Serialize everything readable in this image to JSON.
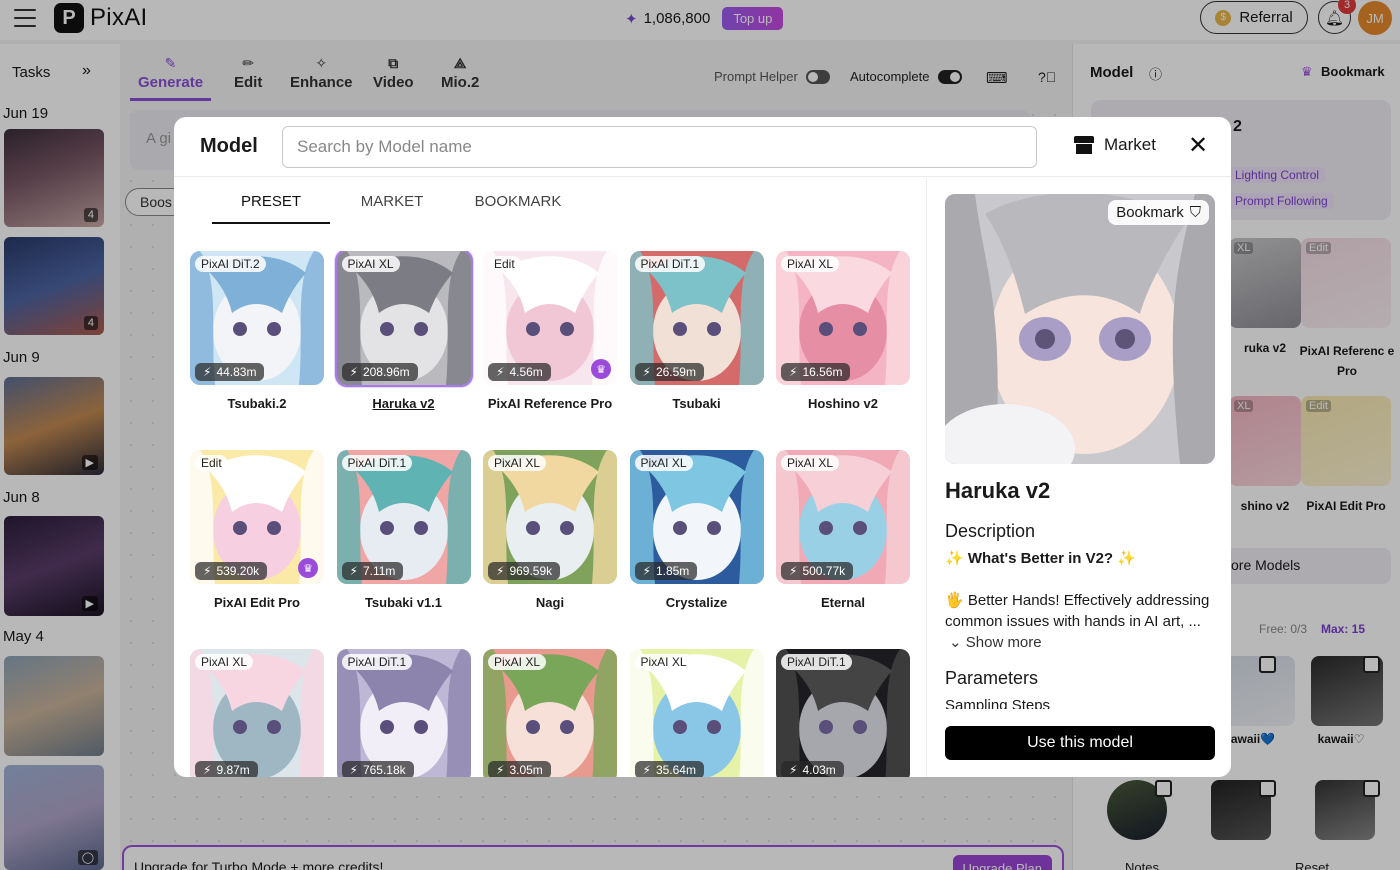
{
  "header": {
    "brand": "PixAI",
    "credits": "1,086,800",
    "topup_label": "Top up",
    "referral_label": "Referral",
    "notification_count": "3",
    "avatar_initials": "JM"
  },
  "tasks": {
    "title": "Tasks",
    "dates": [
      "Jun 19",
      "Jun 9",
      "Jun 8",
      "May 4"
    ],
    "badges": [
      "4",
      "4"
    ]
  },
  "toolbar": {
    "tools": [
      "Generate",
      "Edit",
      "Enhance",
      "Video",
      "Mio.2"
    ],
    "prompt_helper_label": "Prompt Helper",
    "autocomplete_label": "Autocomplete",
    "prompt_placeholder": "A gi",
    "boost_label": "Boos"
  },
  "upgrade": {
    "text": "Upgrade for Turbo Mode + more credits!",
    "button": "Upgrade Plan"
  },
  "right_panel": {
    "title": "Model",
    "bookmark_label": "Bookmark",
    "model_name_partial": "2",
    "pills": [
      "Lighting Control",
      "Prompt Following"
    ],
    "tiles": [
      {
        "tag": "XL",
        "label": "ruka v2"
      },
      {
        "tag": "Edit",
        "label": "PixAI Referenc e Pro"
      },
      {
        "tag": "XL",
        "label": "shino v2"
      },
      {
        "tag": "Edit",
        "label": "PixAI Edit Pro"
      }
    ],
    "more_models_label": "ore Models",
    "free_label": "Free: 0/3",
    "max_label": "Max: 15",
    "loras": [
      "awaii💙",
      "kawaii♡"
    ],
    "bottom_labels": [
      "Notes",
      "Reset"
    ]
  },
  "modal": {
    "title": "Model",
    "search_placeholder": "Search by Model name",
    "market_label": "Market",
    "tabs": [
      "PRESET",
      "MARKET",
      "BOOKMARK"
    ],
    "active_tab": "PRESET",
    "cards": [
      {
        "tag": "PixAI DiT.2",
        "count": "44.83m",
        "name": "Tsubaki.2"
      },
      {
        "tag": "PixAI XL",
        "count": "208.96m",
        "name": "Haruka v2",
        "selected": true
      },
      {
        "tag": "Edit",
        "count": "4.56m",
        "name": "PixAI Reference Pro",
        "premium": true
      },
      {
        "tag": "PixAI DiT.1",
        "count": "26.59m",
        "name": "Tsubaki"
      },
      {
        "tag": "PixAI XL",
        "count": "16.56m",
        "name": "Hoshino v2"
      },
      {
        "tag": "Edit",
        "count": "539.20k",
        "name": "PixAI Edit Pro",
        "premium": true
      },
      {
        "tag": "PixAI DiT.1",
        "count": "7.11m",
        "name": "Tsubaki v1.1"
      },
      {
        "tag": "PixAI XL",
        "count": "969.59k",
        "name": "Nagi"
      },
      {
        "tag": "PixAI XL",
        "count": "1.85m",
        "name": "Crystalize"
      },
      {
        "tag": "PixAI XL",
        "count": "500.77k",
        "name": "Eternal"
      },
      {
        "tag": "PixAI XL",
        "count": "9.87m",
        "name": ""
      },
      {
        "tag": "PixAI DiT.1",
        "count": "765.18k",
        "name": ""
      },
      {
        "tag": "PixAI XL",
        "count": "3.05m",
        "name": ""
      },
      {
        "tag": "PixAI XL",
        "count": "35.64m",
        "name": ""
      },
      {
        "tag": "PixAI DiT.1",
        "count": "4.03m",
        "name": ""
      }
    ],
    "detail": {
      "bookmark_label": "Bookmark",
      "name": "Haruka v2",
      "description_heading": "Description",
      "tagline": "✨ What's Better in V2? ✨",
      "body": "🖐 Better Hands! Effectively addressing common issues with hands in AI art, ...",
      "show_more": "Show more",
      "parameters_heading": "Parameters",
      "sampling_label": "Sampling Steps",
      "use_button": "Use this model"
    }
  },
  "colors": {
    "accent": "#8a4fd8",
    "topup_gradient": [
      "#9b5cf0",
      "#c74ae0"
    ],
    "premium": "#9b4bd9",
    "selected_outline": "#a779e9"
  }
}
